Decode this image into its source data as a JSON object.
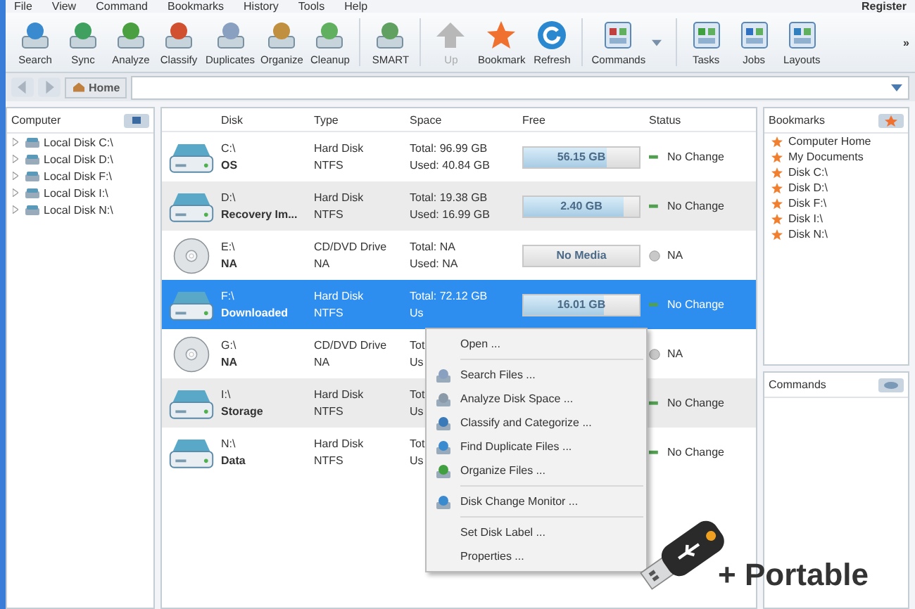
{
  "menu_bar": {
    "items": [
      "File",
      "View",
      "Command",
      "Bookmarks",
      "History",
      "Tools",
      "Help"
    ],
    "register": "Register"
  },
  "toolbar": {
    "groups": [
      [
        {
          "label": "Search",
          "disabled": false
        },
        {
          "label": "Sync",
          "disabled": false
        },
        {
          "label": "Analyze",
          "disabled": false
        },
        {
          "label": "Classify",
          "disabled": false
        },
        {
          "label": "Duplicates",
          "disabled": false
        },
        {
          "label": "Organize",
          "disabled": false
        },
        {
          "label": "Cleanup",
          "disabled": false
        }
      ],
      [
        {
          "label": "SMART",
          "disabled": false
        }
      ],
      [
        {
          "label": "Up",
          "disabled": true
        },
        {
          "label": "Bookmark",
          "disabled": false
        },
        {
          "label": "Refresh",
          "disabled": false
        }
      ],
      [
        {
          "label": "Commands",
          "disabled": false
        }
      ],
      [
        {
          "label": "Tasks",
          "disabled": false
        },
        {
          "label": "Jobs",
          "disabled": false
        },
        {
          "label": "Layouts",
          "disabled": false
        }
      ]
    ],
    "overflow": "»"
  },
  "nav_bar": {
    "home": "Home"
  },
  "computer_panel": {
    "title": "Computer",
    "items": [
      {
        "label": "Local Disk C:\\"
      },
      {
        "label": "Local Disk D:\\"
      },
      {
        "label": "Local Disk F:\\"
      },
      {
        "label": "Local Disk I:\\"
      },
      {
        "label": "Local Disk N:\\"
      }
    ]
  },
  "table": {
    "columns": [
      "Disk",
      "Type",
      "Space",
      "Free",
      "Status"
    ],
    "rows": [
      {
        "kind": "hdd",
        "disk": "C:\\",
        "label": "OS",
        "type": "Hard Disk",
        "fs": "NTFS",
        "total": "Total: 96.99 GB",
        "used": "Used: 40.84 GB",
        "free": {
          "kind": "bar",
          "text": "56.15 GB",
          "level": 0.72
        },
        "status": {
          "kind": "ok",
          "text": "No Change"
        },
        "selected": false
      },
      {
        "kind": "hdd",
        "disk": "D:\\",
        "label": "Recovery Im...",
        "type": "Hard Disk",
        "fs": "NTFS",
        "total": "Total: 19.38 GB",
        "used": "Used: 16.99 GB",
        "free": {
          "kind": "bar",
          "text": "2.40 GB",
          "level": 0.86
        },
        "status": {
          "kind": "ok",
          "text": "No Change"
        },
        "selected": false
      },
      {
        "kind": "cd",
        "disk": "E:\\",
        "label": "NA",
        "type": "CD/DVD Drive",
        "fs": "NA",
        "total": "Total: NA",
        "used": "Used: NA",
        "free": {
          "kind": "empty",
          "text": "No Media"
        },
        "status": {
          "kind": "na",
          "text": "NA"
        },
        "selected": false
      },
      {
        "kind": "hdd",
        "disk": "F:\\",
        "label": "Downloaded",
        "type": "Hard Disk",
        "fs": "NTFS",
        "total": "Total: 72.12 GB",
        "used": "Us",
        "free": {
          "kind": "bar",
          "text": "16.01 GB",
          "level": 0.7
        },
        "status": {
          "kind": "ok",
          "text": "No Change"
        },
        "selected": true
      },
      {
        "kind": "cd",
        "disk": "G:\\",
        "label": "NA",
        "type": "CD/DVD Drive",
        "fs": "NA",
        "total": "Tot",
        "used": "Us",
        "status": {
          "kind": "na",
          "text": "NA"
        },
        "selected": false
      },
      {
        "kind": "hdd",
        "disk": "I:\\",
        "label": "Storage",
        "type": "Hard Disk",
        "fs": "NTFS",
        "total": "Tot",
        "used": "Us",
        "status": {
          "kind": "ok",
          "text": "No Change"
        },
        "selected": false
      },
      {
        "kind": "hdd",
        "disk": "N:\\",
        "label": "Data",
        "type": "Hard Disk",
        "fs": "NTFS",
        "total": "Tot",
        "used": "Us",
        "status": {
          "kind": "ok",
          "text": "No Change"
        },
        "selected": false
      }
    ]
  },
  "bookmarks_panel": {
    "title": "Bookmarks",
    "items": [
      "Computer Home",
      "My Documents",
      "Disk C:\\",
      "Disk D:\\",
      "Disk F:\\",
      "Disk I:\\",
      "Disk N:\\"
    ]
  },
  "commands_panel": {
    "title": "Commands"
  },
  "context_menu": {
    "groups": [
      [
        {
          "label": "Open ...",
          "kind": "plain"
        }
      ],
      [
        {
          "label": "Search Files ...",
          "kind": "tool"
        },
        {
          "label": "Analyze Disk Space ...",
          "kind": "tool"
        },
        {
          "label": "Classify and Categorize ...",
          "kind": "tool"
        },
        {
          "label": "Find Duplicate Files ...",
          "kind": "tool"
        },
        {
          "label": "Organize Files ...",
          "kind": "tool"
        }
      ],
      [
        {
          "label": "Disk Change Monitor ...",
          "kind": "tool"
        }
      ],
      [
        {
          "label": "Set Disk Label ...",
          "kind": "plain"
        },
        {
          "label": "Properties ...",
          "kind": "plain"
        }
      ]
    ]
  },
  "promo": {
    "text": "+ Portable"
  }
}
